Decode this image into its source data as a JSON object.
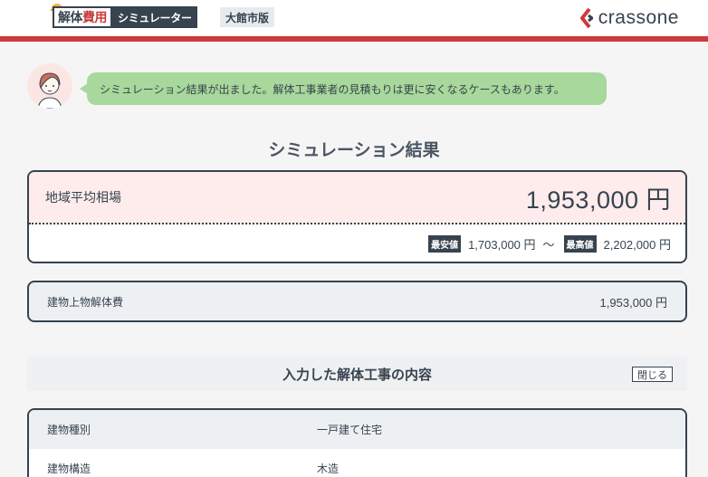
{
  "header": {
    "logo_part1": "解体",
    "logo_part2": "費用",
    "logo_sub": "シミュレーター",
    "city": "大館市版",
    "brand": "crassone"
  },
  "advisor": {
    "message": "シミュレーション結果が出ました。解体工事業者の見積もりは更に安くなるケースもあります。"
  },
  "result": {
    "title": "シミュレーション結果",
    "label": "地域平均相場",
    "price": "1,953,000 円",
    "min_label": "最安値",
    "min_value": "1,703,000 円",
    "tilde": "〜",
    "max_label": "最高値",
    "max_value": "2,202,000 円"
  },
  "fee": {
    "label": "建物上物解体費",
    "value": "1,953,000 円"
  },
  "details": {
    "title": "入力した解体工事の内容",
    "close_label": "閉じる",
    "rows": [
      {
        "key": "建物種別",
        "value": "一戸建て住宅"
      },
      {
        "key": "建物構造",
        "value": "木造"
      }
    ]
  },
  "colors": {
    "accent_red": "#cd3a3c",
    "text_dark": "#37434f",
    "bubble_green": "#a8d89b",
    "result_pink": "#fdeceb"
  }
}
